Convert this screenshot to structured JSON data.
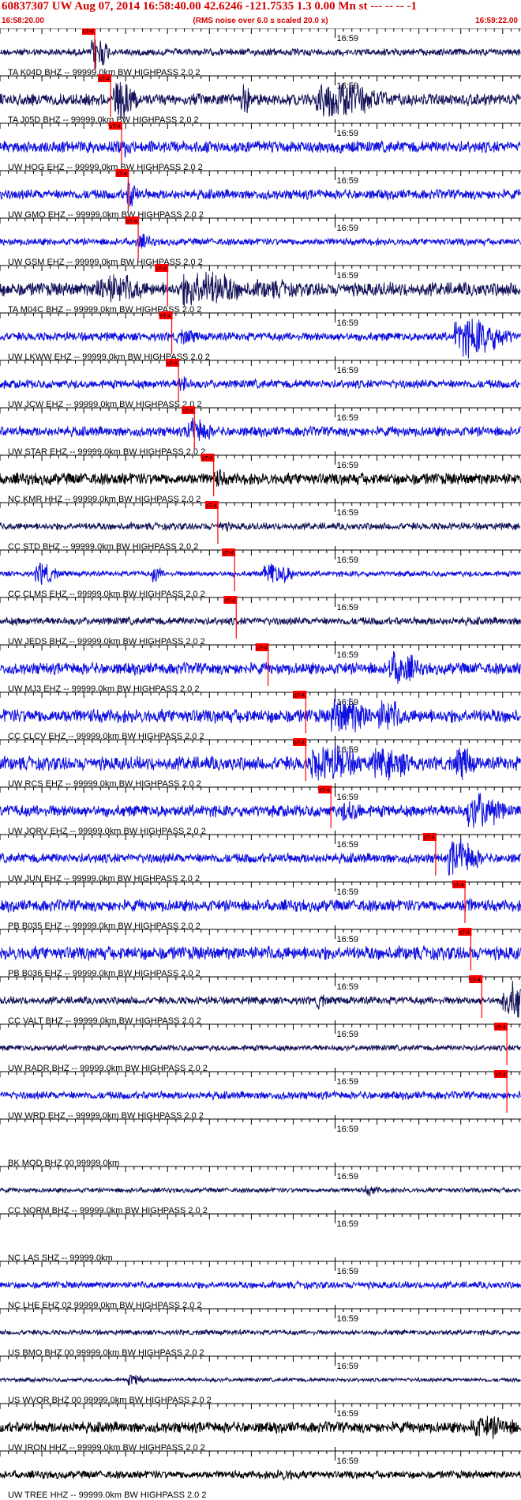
{
  "header": {
    "title": "60837307 UW Aug 07, 2014 16:58:40.00   42.6246 -121.7535  1.3 0.00 Mn st --- -- --   -1",
    "start_time": "16:58:20.00",
    "rms_note": "(RMS noise over 6.0 s scaled 20.0 x)",
    "end_time": "16:59:22.00"
  },
  "chart_data": {
    "type": "seismogram",
    "x_range_seconds": [
      0,
      62
    ],
    "minute_mark": {
      "label": "16:59",
      "t": 40
    },
    "pick_label": "sT-4",
    "colors": {
      "blue": "#1010e0",
      "navy": "#14145a",
      "black": "#000000",
      "pick": "#ff0000",
      "grid": "#000000"
    },
    "traces": [
      {
        "label": "TA K04D BHZ -- 99999.0km BW  HIGHPASS  2.0  2",
        "color": "navy",
        "amp": 0.18,
        "pick": 11.3,
        "events": [
          [
            11.5,
            1.0,
            1.6
          ]
        ]
      },
      {
        "label": "TA J05D BHZ -- 99999.0km BW  HIGHPASS  2.0  2",
        "color": "navy",
        "amp": 0.3,
        "pick": 13.2,
        "events": [
          [
            14.5,
            1.0,
            2.5
          ],
          [
            29.0,
            0.9,
            1.0
          ],
          [
            40.0,
            1.0,
            6.0
          ],
          [
            44.5,
            0.5,
            4.0
          ]
        ]
      },
      {
        "label": "UW HOG EHZ -- 99999.0km BW  HIGHPASS  2.0  2",
        "color": "blue",
        "amp": 0.3,
        "pick": 14.5,
        "events": [
          [
            15.0,
            0.6,
            1.5
          ]
        ]
      },
      {
        "label": "UW GMO EHZ -- 99999.0km BW  HIGHPASS  2.0  2",
        "color": "blue",
        "amp": 0.25,
        "pick": 15.3,
        "events": [
          [
            15.5,
            0.8,
            1.2
          ]
        ]
      },
      {
        "label": "UW GSM EHZ -- 99999.0km BW  HIGHPASS  2.0  2",
        "color": "blue",
        "amp": 0.18,
        "pick": 16.5,
        "events": [
          [
            16.8,
            0.4,
            2.0
          ]
        ]
      },
      {
        "label": "TA M04C BHZ -- 99999.0km BW  HIGHPASS  2.0  2",
        "color": "navy",
        "amp": 0.35,
        "pick": 20.0,
        "events": [
          [
            13.5,
            0.8,
            5.0
          ],
          [
            24.0,
            1.0,
            6.0
          ],
          [
            32.0,
            0.5,
            6.0
          ]
        ]
      },
      {
        "label": "UW LKWW EHZ -- 99999.0km BW  HIGHPASS  2.0  2",
        "color": "blue",
        "amp": 0.22,
        "pick": 20.5,
        "events": [
          [
            22.0,
            0.4,
            2.5
          ],
          [
            56.0,
            1.0,
            5.0
          ]
        ]
      },
      {
        "label": "UW JCW EHZ -- 99999.0km BW  HIGHPASS  2.0  2",
        "color": "blue",
        "amp": 0.22,
        "pick": 21.3,
        "events": [
          [
            21.8,
            0.5,
            1.2
          ]
        ]
      },
      {
        "label": "UW STAR EHZ -- 99999.0km BW  HIGHPASS  2.0  2",
        "color": "blue",
        "amp": 0.25,
        "pick": 23.2,
        "events": [
          [
            23.2,
            0.7,
            2.5
          ]
        ]
      },
      {
        "label": "NC KMR HHZ -- 99999.0km BW  HIGHPASS  2.0  2",
        "color": "black",
        "amp": 0.3,
        "pick": 25.5,
        "events": [
          [
            26.0,
            0.5,
            1.5
          ]
        ]
      },
      {
        "label": "CC STD BHZ -- 99999.0km BW  HIGHPASS  2.0  2",
        "color": "navy",
        "amp": 0.18,
        "pick": 26.0,
        "events": [
          [
            26.5,
            0.3,
            1.5
          ]
        ]
      },
      {
        "label": "CC CLMS EHZ -- 99999.0km BW  HIGHPASS  2.0  2",
        "color": "blue",
        "amp": 0.14,
        "pick": 28.0,
        "events": [
          [
            5.0,
            0.6,
            2.0
          ],
          [
            18.5,
            0.5,
            1.0
          ],
          [
            32.5,
            0.6,
            3.0
          ]
        ]
      },
      {
        "label": "UW JEDS BHZ -- 99999.0km BW  HIGHPASS  2.0  2",
        "color": "navy",
        "amp": 0.2,
        "pick": 28.2,
        "events": []
      },
      {
        "label": "UW MJ3 EHZ -- 99999.0km BW  HIGHPASS  2.0  2",
        "color": "blue",
        "amp": 0.3,
        "pick": 32.0,
        "events": [
          [
            47.5,
            0.9,
            3.0
          ]
        ]
      },
      {
        "label": "CC CLCV EHZ -- 99999.0km BW  HIGHPASS  2.0  2",
        "color": "blue",
        "amp": 0.35,
        "pick": 36.5,
        "events": [
          [
            41.0,
            1.0,
            4.0
          ],
          [
            46.0,
            0.9,
            2.5
          ]
        ]
      },
      {
        "label": "UW RCS EHZ -- 99999.0km BW  HIGHPASS  2.0  2",
        "color": "blue",
        "amp": 0.35,
        "pick": 36.5,
        "events": [
          [
            39.0,
            1.0,
            5.0
          ],
          [
            46.0,
            0.8,
            5.0
          ],
          [
            55.0,
            0.9,
            2.0
          ]
        ]
      },
      {
        "label": "UW JORV EHZ -- 99999.0km BW  HIGHPASS  2.0  2",
        "color": "blue",
        "amp": 0.3,
        "pick": 39.5,
        "events": [
          [
            41.5,
            0.6,
            2.5
          ],
          [
            57.0,
            1.0,
            3.5
          ]
        ]
      },
      {
        "label": "UW JUN EHZ -- 99999.0km BW  HIGHPASS  2.0  2",
        "color": "blue",
        "amp": 0.25,
        "pick": 52.0,
        "events": [
          [
            54.5,
            1.0,
            3.0
          ]
        ]
      },
      {
        "label": "PB B035 EHZ -- 99999.0km BW  HIGHPASS  2.0  2",
        "color": "blue",
        "amp": 0.3,
        "pick": 55.5,
        "events": [
          [
            55.5,
            0.5,
            1.2
          ]
        ]
      },
      {
        "label": "PB B036 EHZ -- 99999.0km BW  HIGHPASS  2.0  2",
        "color": "blue",
        "amp": 0.35,
        "pick": 56.2,
        "events": [
          [
            56.0,
            0.4,
            1.2
          ]
        ]
      },
      {
        "label": "CC VALT BHZ -- 99999.0km BW  HIGHPASS  2.0  2",
        "color": "navy",
        "amp": 0.2,
        "pick": 57.5,
        "events": [
          [
            38.0,
            0.5,
            0.8
          ],
          [
            61.0,
            1.0,
            3.0
          ]
        ]
      },
      {
        "label": "UW RADR BHZ -- 99999.0km BW  HIGHPASS  2.0  2",
        "color": "navy",
        "amp": 0.15,
        "pick": 60.5,
        "events": []
      },
      {
        "label": "UW WRD EHZ -- 99999.0km BW  HIGHPASS  2.0  2",
        "color": "blue",
        "amp": 0.2,
        "pick": 60.5,
        "events": []
      },
      {
        "label": "BK MOD BHZ 00 99999.0km",
        "color": "navy",
        "amp": 0,
        "pick": null,
        "events": []
      },
      {
        "label": "CC NORM BHZ -- 99999.0km BW  HIGHPASS  2.0  2",
        "color": "navy",
        "amp": 0.12,
        "pick": null,
        "events": [
          [
            44.0,
            0.3,
            1.5
          ]
        ]
      },
      {
        "label": "NC LAS SHZ -- 99999.0km",
        "color": "blue",
        "amp": 0,
        "pick": null,
        "events": []
      },
      {
        "label": "NC LHE EHZ 02 99999.0km BW  HIGHPASS  2.0  2",
        "color": "blue",
        "amp": 0.18,
        "pick": null,
        "events": []
      },
      {
        "label": "US BMO BHZ 00 99999.0km BW  HIGHPASS  2.0  2",
        "color": "navy",
        "amp": 0.13,
        "pick": null,
        "events": []
      },
      {
        "label": "US WVOR BHZ 00 99999.0km BW  HIGHPASS  2.0  2",
        "color": "navy",
        "amp": 0.1,
        "pick": null,
        "events": [
          [
            16.0,
            0.3,
            2.0
          ]
        ]
      },
      {
        "label": "UW IRON HHZ -- 99999.0km BW  HIGHPASS  2.0  2",
        "color": "black",
        "amp": 0.28,
        "pick": null,
        "events": [
          [
            58.0,
            0.6,
            5.0
          ]
        ]
      },
      {
        "label": "UW TREE HHZ -- 99999.0km BW  HIGHPASS  2.0  2",
        "color": "black",
        "amp": 0.2,
        "pick": null,
        "events": [
          [
            34.0,
            0.3,
            3.0
          ]
        ]
      }
    ]
  }
}
